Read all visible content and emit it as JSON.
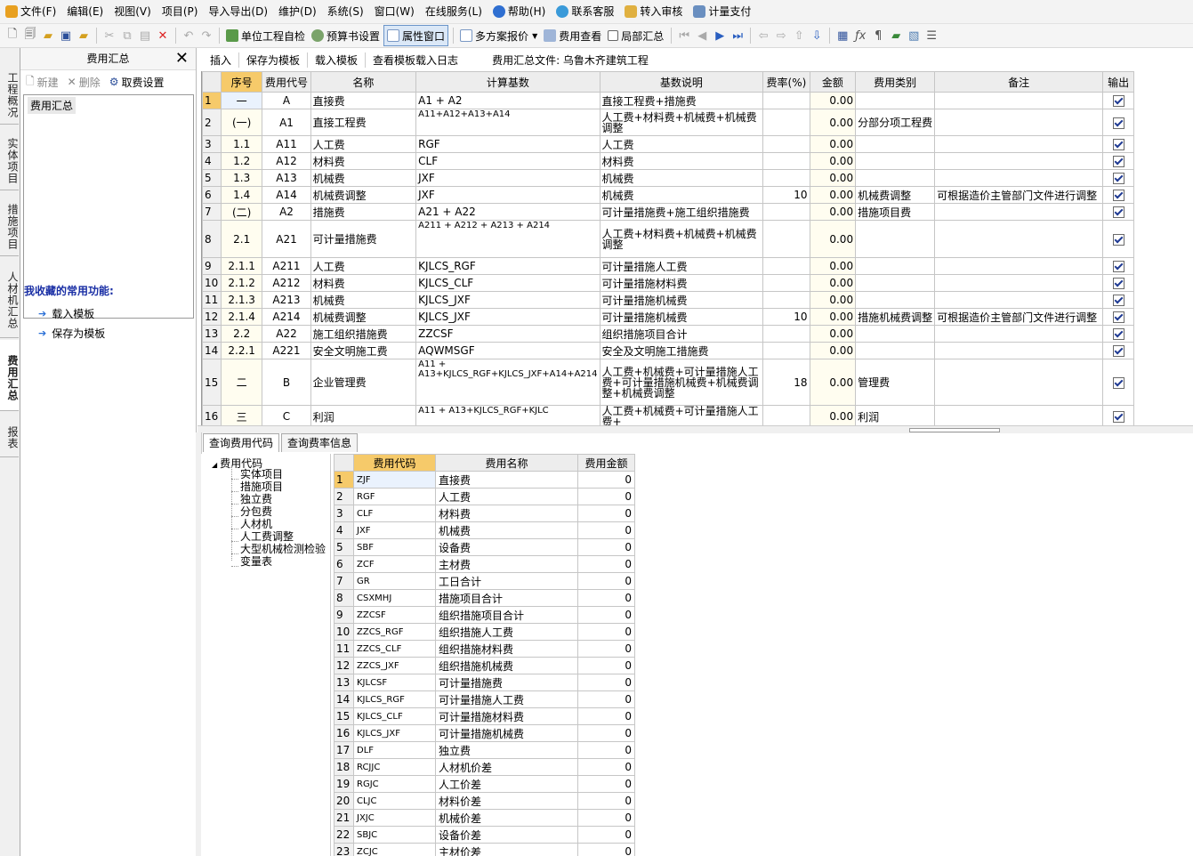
{
  "menu": [
    {
      "label": "文件(F)",
      "icon": "app-logo-icon"
    },
    {
      "label": "编辑(E)"
    },
    {
      "label": "视图(V)"
    },
    {
      "label": "项目(P)"
    },
    {
      "label": "导入导出(D)"
    },
    {
      "label": "维护(D)"
    },
    {
      "label": "系统(S)"
    },
    {
      "label": "窗口(W)"
    },
    {
      "label": "在线服务(L)"
    },
    {
      "label": "帮助(H)",
      "icon": "help-icon"
    },
    {
      "label": "联系客服",
      "icon": "customer-service-icon"
    },
    {
      "label": "转入审核",
      "icon": "audit-icon"
    },
    {
      "label": "计量支付",
      "icon": "payment-icon"
    }
  ],
  "toolbar": {
    "self_check": "单位工程自检",
    "budget_settings": "预算书设置",
    "property_window": "属性窗口",
    "multi_plan": "多方案报价",
    "fee_view": "费用查看",
    "local_summary": "局部汇总"
  },
  "left_tabs": [
    "工程概况",
    "实体项目",
    "措施项目",
    "人材机汇总",
    "费用汇总",
    "报表"
  ],
  "left_panel": {
    "title": "费用汇总",
    "new": "新建",
    "delete": "删除",
    "fee_settings": "取费设置",
    "tree_item": "费用汇总",
    "favorites_title": "我收藏的常用功能:",
    "favorites": [
      "载入模板",
      "保存为模板"
    ]
  },
  "fee_toolbar": {
    "insert": "插入",
    "save_template": "保存为模板",
    "load_template": "载入模板",
    "view_log": "查看模板载入日志",
    "file_label": "费用汇总文件: 乌鲁木齐建筑工程"
  },
  "fee_table": {
    "headers": [
      "序号",
      "费用代号",
      "名称",
      "计算基数",
      "基数说明",
      "费率(%)",
      "金额",
      "费用类别",
      "备注",
      "输出"
    ],
    "rows": [
      {
        "no": "1",
        "seq": "一",
        "code": "A",
        "name": "直接费",
        "base": "A1 + A2",
        "desc": "直接工程费+措施费",
        "rate": "",
        "amount": "0.00",
        "cat": "",
        "note": ""
      },
      {
        "no": "2",
        "seq": "(一)",
        "code": "A1",
        "name": "直接工程费",
        "base": "A11+A12+A13+A14",
        "desc": "人工费+材料费+机械费+机械费调整",
        "rate": "",
        "amount": "0.00",
        "cat": "分部分项工程费",
        "note": ""
      },
      {
        "no": "3",
        "seq": "1.1",
        "code": "A11",
        "name": "人工费",
        "base": "RGF",
        "desc": "人工费",
        "rate": "",
        "amount": "0.00",
        "cat": "",
        "note": ""
      },
      {
        "no": "4",
        "seq": "1.2",
        "code": "A12",
        "name": "材料费",
        "base": "CLF",
        "desc": "材料费",
        "rate": "",
        "amount": "0.00",
        "cat": "",
        "note": ""
      },
      {
        "no": "5",
        "seq": "1.3",
        "code": "A13",
        "name": "机械费",
        "base": "JXF",
        "desc": "机械费",
        "rate": "",
        "amount": "0.00",
        "cat": "",
        "note": ""
      },
      {
        "no": "6",
        "seq": "1.4",
        "code": "A14",
        "name": "机械费调整",
        "base": "JXF",
        "desc": "机械费",
        "rate": "10",
        "amount": "0.00",
        "cat": "机械费调整",
        "note": "可根据造价主管部门文件进行调整"
      },
      {
        "no": "7",
        "seq": "(二)",
        "code": "A2",
        "name": "措施费",
        "base": "A21 + A22",
        "desc": "可计量措施费+施工组织措施费",
        "rate": "",
        "amount": "0.00",
        "cat": "措施项目费",
        "note": ""
      },
      {
        "no": "8",
        "seq": "2.1",
        "code": "A21",
        "name": "可计量措施费",
        "base": "A211 + A212 + A213 + A214",
        "desc": "人工费+材料费+机械费+机械费调整",
        "rate": "",
        "amount": "0.00",
        "cat": "",
        "note": ""
      },
      {
        "no": "9",
        "seq": "2.1.1",
        "code": "A211",
        "name": "人工费",
        "base": "KJLCS_RGF",
        "desc": "可计量措施人工费",
        "rate": "",
        "amount": "0.00",
        "cat": "",
        "note": ""
      },
      {
        "no": "10",
        "seq": "2.1.2",
        "code": "A212",
        "name": "材料费",
        "base": "KJLCS_CLF",
        "desc": "可计量措施材料费",
        "rate": "",
        "amount": "0.00",
        "cat": "",
        "note": ""
      },
      {
        "no": "11",
        "seq": "2.1.3",
        "code": "A213",
        "name": "机械费",
        "base": "KJLCS_JXF",
        "desc": "可计量措施机械费",
        "rate": "",
        "amount": "0.00",
        "cat": "",
        "note": ""
      },
      {
        "no": "12",
        "seq": "2.1.4",
        "code": "A214",
        "name": "机械费调整",
        "base": "KJLCS_JXF",
        "desc": "可计量措施机械费",
        "rate": "10",
        "amount": "0.00",
        "cat": "措施机械费调整",
        "note": "可根据造价主管部门文件进行调整"
      },
      {
        "no": "13",
        "seq": "2.2",
        "code": "A22",
        "name": "施工组织措施费",
        "base": "ZZCSF",
        "desc": "组织措施项目合计",
        "rate": "",
        "amount": "0.00",
        "cat": "",
        "note": ""
      },
      {
        "no": "14",
        "seq": "2.2.1",
        "code": "A221",
        "name": "安全文明施工费",
        "base": "AQWMSGF",
        "desc": "安全及文明施工措施费",
        "rate": "",
        "amount": "0.00",
        "cat": "",
        "note": ""
      },
      {
        "no": "15",
        "seq": "二",
        "code": "B",
        "name": "企业管理费",
        "base": "A11 + A13+KJLCS_RGF+KJLCS_JXF+A14+A214",
        "desc": "人工费+机械费+可计量措施人工费+可计量措施机械费+机械费调整+机械费调整",
        "rate": "18",
        "amount": "0.00",
        "cat": "管理费",
        "note": ""
      },
      {
        "no": "16",
        "seq": "三",
        "code": "C",
        "name": "利润",
        "base": "A11 + A13+KJLCS_RGF+KJLC",
        "desc": "人工费+机械费+可计量措施人工费+",
        "rate": "",
        "amount": "0.00",
        "cat": "利润",
        "note": ""
      }
    ]
  },
  "bottom_tabs": [
    "查询费用代码",
    "查询费率信息"
  ],
  "code_tree": {
    "root": "费用代码",
    "items": [
      "实体项目",
      "措施项目",
      "独立费",
      "分包费",
      "人材机",
      "人工费调整",
      "大型机械检测检验",
      "变量表"
    ]
  },
  "code_table": {
    "headers": [
      "费用代码",
      "费用名称",
      "费用金额"
    ],
    "rows": [
      {
        "no": "1",
        "code": "ZJF",
        "name": "直接费",
        "amount": "0"
      },
      {
        "no": "2",
        "code": "RGF",
        "name": "人工费",
        "amount": "0"
      },
      {
        "no": "3",
        "code": "CLF",
        "name": "材料费",
        "amount": "0"
      },
      {
        "no": "4",
        "code": "JXF",
        "name": "机械费",
        "amount": "0"
      },
      {
        "no": "5",
        "code": "SBF",
        "name": "设备费",
        "amount": "0"
      },
      {
        "no": "6",
        "code": "ZCF",
        "name": "主材费",
        "amount": "0"
      },
      {
        "no": "7",
        "code": "GR",
        "name": "工日合计",
        "amount": "0"
      },
      {
        "no": "8",
        "code": "CSXMHJ",
        "name": "措施项目合计",
        "amount": "0"
      },
      {
        "no": "9",
        "code": "ZZCSF",
        "name": "组织措施项目合计",
        "amount": "0"
      },
      {
        "no": "10",
        "code": "ZZCS_RGF",
        "name": "组织措施人工费",
        "amount": "0"
      },
      {
        "no": "11",
        "code": "ZZCS_CLF",
        "name": "组织措施材料费",
        "amount": "0"
      },
      {
        "no": "12",
        "code": "ZZCS_JXF",
        "name": "组织措施机械费",
        "amount": "0"
      },
      {
        "no": "13",
        "code": "KJLCSF",
        "name": "可计量措施费",
        "amount": "0"
      },
      {
        "no": "14",
        "code": "KJLCS_RGF",
        "name": "可计量措施人工费",
        "amount": "0"
      },
      {
        "no": "15",
        "code": "KJLCS_CLF",
        "name": "可计量措施材料费",
        "amount": "0"
      },
      {
        "no": "16",
        "code": "KJLCS_JXF",
        "name": "可计量措施机械费",
        "amount": "0"
      },
      {
        "no": "17",
        "code": "DLF",
        "name": "独立费",
        "amount": "0"
      },
      {
        "no": "18",
        "code": "RCJJC",
        "name": "人材机价差",
        "amount": "0"
      },
      {
        "no": "19",
        "code": "RGJC",
        "name": "人工价差",
        "amount": "0"
      },
      {
        "no": "20",
        "code": "CLJC",
        "name": "材料价差",
        "amount": "0"
      },
      {
        "no": "21",
        "code": "JXJC",
        "name": "机械价差",
        "amount": "0"
      },
      {
        "no": "22",
        "code": "SBJC",
        "name": "设备价差",
        "amount": "0"
      },
      {
        "no": "23",
        "code": "ZCJC",
        "name": "主材价差",
        "amount": "0"
      }
    ]
  },
  "colors": {
    "selected_header": "#f6ca6a",
    "accent": "#1a2fa5"
  }
}
